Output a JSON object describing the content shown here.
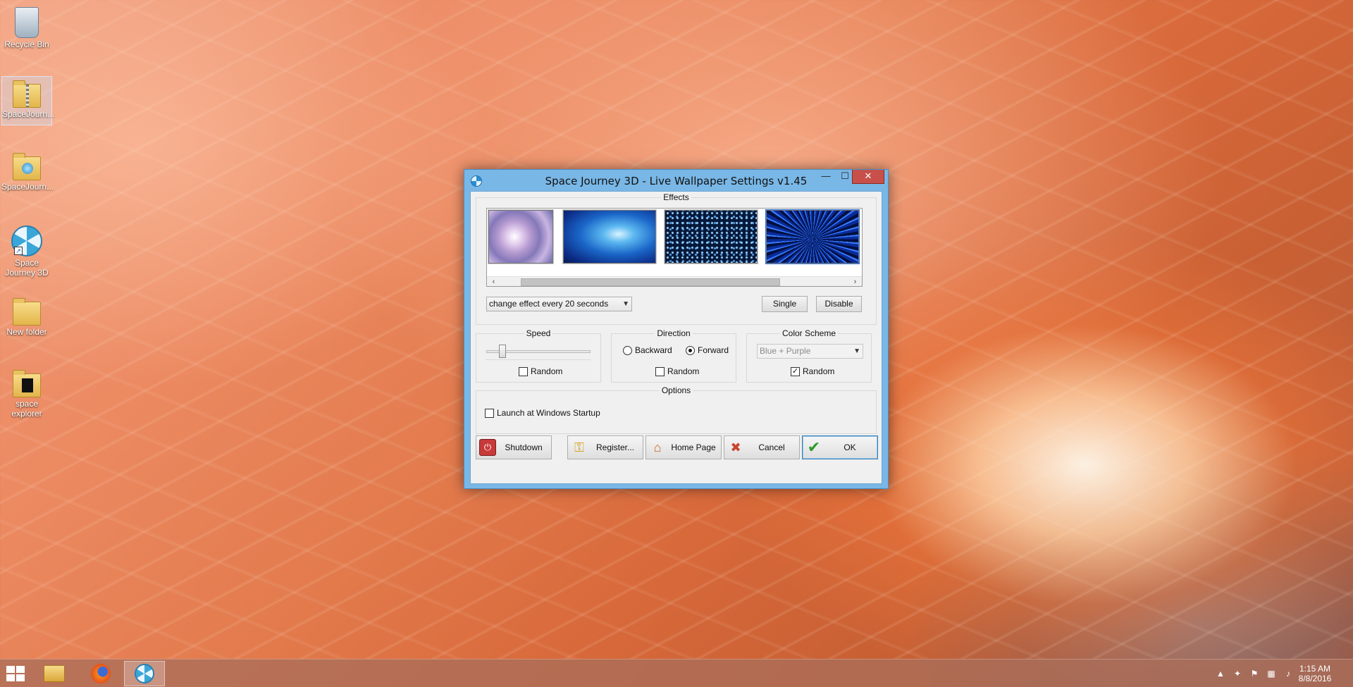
{
  "desktop": {
    "icons": [
      {
        "label": "Recycle Bin"
      },
      {
        "label": "SpaceJourn..."
      },
      {
        "label": "SpaceJourn..."
      },
      {
        "label": "Space Journey 3D"
      },
      {
        "label": "New folder"
      },
      {
        "label": "space explorer"
      }
    ]
  },
  "dialog": {
    "title": "Space Journey 3D - Live Wallpaper Settings  v1.45",
    "controls": {
      "minimize": "—",
      "maximize": "☐",
      "close": "✕"
    },
    "effects": {
      "group_label": "Effects",
      "scroll_left": "‹",
      "scroll_right": "›",
      "interval_select": "change effect every 20 seconds",
      "single_button": "Single",
      "disable_button": "Disable"
    },
    "speed": {
      "group_label": "Speed",
      "random_label": "Random",
      "random_checked": false
    },
    "direction": {
      "group_label": "Direction",
      "backward_label": "Backward",
      "forward_label": "Forward",
      "selected": "Forward",
      "random_label": "Random",
      "random_checked": false
    },
    "color_scheme": {
      "group_label": "Color Scheme",
      "selected": "Blue + Purple",
      "random_label": "Random",
      "random_checked": true,
      "check_mark": "✓"
    },
    "options": {
      "group_label": "Options",
      "startup_label": "Launch at Windows Startup",
      "startup_checked": false
    },
    "buttons": {
      "shutdown": "Shutdown",
      "register": "Register...",
      "home_page": "Home Page",
      "cancel": "Cancel",
      "ok": "OK"
    }
  },
  "taskbar": {
    "clock_time": "1:15 AM",
    "clock_date": "8/8/2016"
  }
}
